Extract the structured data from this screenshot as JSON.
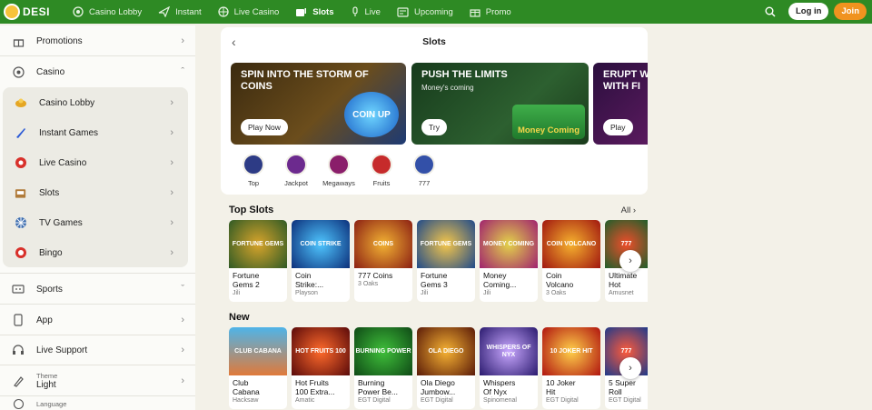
{
  "brand": {
    "name": "DESI"
  },
  "nav": {
    "items": [
      {
        "label": "Casino Lobby",
        "icon": "casino-chip-icon"
      },
      {
        "label": "Instant",
        "icon": "plane-icon"
      },
      {
        "label": "Live Casino",
        "icon": "roulette-icon"
      },
      {
        "label": "Slots",
        "icon": "slot-machine-icon",
        "active": true
      },
      {
        "label": "Live",
        "icon": "microphone-icon"
      },
      {
        "label": "Upcoming",
        "icon": "calendar-icon"
      },
      {
        "label": "Promo",
        "icon": "gift-icon"
      }
    ],
    "login": "Log in",
    "join": "Join"
  },
  "sidebar": {
    "promotions": "Promotions",
    "casino": "Casino",
    "casino_items": [
      "Casino Lobby",
      "Instant Games",
      "Live Casino",
      "Slots",
      "TV Games",
      "Bingo"
    ],
    "sports": "Sports",
    "app": "App",
    "support": "Live Support",
    "theme_label": "Theme",
    "theme_value": "Light",
    "language_label": "Language"
  },
  "slots_panel": {
    "title": "Slots",
    "banners": [
      {
        "title": "SPIN INTO THE STORM OF COINS",
        "subtitle": "",
        "button": "Play Now",
        "art": "COIN UP"
      },
      {
        "title": "PUSH THE LIMITS",
        "subtitle": "Money's coming",
        "button": "Try",
        "art": "Money Coming"
      },
      {
        "title": "ERUPT W WITH FI",
        "subtitle": "",
        "button": "Play",
        "art": ""
      }
    ],
    "categories": [
      "Top",
      "Jackpot",
      "Megaways",
      "Fruits",
      "777"
    ]
  },
  "top_slots": {
    "title": "Top Slots",
    "all": "All",
    "games": [
      {
        "name1": "Fortune",
        "name2": "Gems 2",
        "provider": "Jili",
        "art": "FORTUNE GEMS"
      },
      {
        "name1": "Coin",
        "name2": "Strike:...",
        "provider": "Playson",
        "art": "COIN STRIKE"
      },
      {
        "name1": "777 Coins",
        "name2": "",
        "provider": "3 Oaks",
        "art": "COINS"
      },
      {
        "name1": "Fortune",
        "name2": "Gems 3",
        "provider": "Jili",
        "art": "FORTUNE GEMS"
      },
      {
        "name1": "Money",
        "name2": "Coming...",
        "provider": "Jili",
        "art": "MONEY COMING"
      },
      {
        "name1": "Coin",
        "name2": "Volcano",
        "provider": "3 Oaks",
        "art": "COIN VOLCANO"
      },
      {
        "name1": "Ultimate",
        "name2": "Hot",
        "provider": "Amusnet",
        "art": "777"
      }
    ]
  },
  "new_games": {
    "title": "New",
    "games": [
      {
        "name1": "Club",
        "name2": "Cabana",
        "provider": "Hacksaw",
        "art": "CLUB CABANA"
      },
      {
        "name1": "Hot Fruits",
        "name2": "100 Extra...",
        "provider": "Amatic",
        "art": "HOT FRUITS 100"
      },
      {
        "name1": "Burning",
        "name2": "Power Be...",
        "provider": "EGT Digital",
        "art": "BURNING POWER"
      },
      {
        "name1": "Ola Diego",
        "name2": "Jumbow...",
        "provider": "EGT Digital",
        "art": "OLA DIEGO"
      },
      {
        "name1": "Whispers",
        "name2": "Of Nyx",
        "provider": "Spinomenal",
        "art": "WHISPERS OF NYX"
      },
      {
        "name1": "10 Joker",
        "name2": "Hit",
        "provider": "EGT Digital",
        "art": "10 JOKER HIT"
      },
      {
        "name1": "5 Super",
        "name2": "Roll",
        "provider": "EGT Digital",
        "art": "777"
      }
    ]
  },
  "colors": {
    "brand_green": "#2e8a24",
    "join_orange": "#f0931f"
  }
}
